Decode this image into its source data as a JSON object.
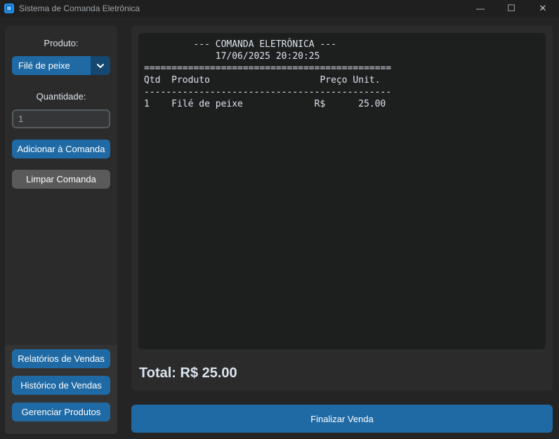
{
  "window": {
    "title": "Sistema de Comanda Eletrônica",
    "minimize_glyph": "—",
    "maximize_glyph": "☐",
    "close_glyph": "✕"
  },
  "sidebar": {
    "produto_label": "Produto:",
    "produto_selected": "Filé de peixe",
    "quantidade_label": "Quantidade:",
    "quantidade_value": "1",
    "add_button": "Adicionar à Comanda",
    "clear_button": "Limpar Comanda",
    "reports_button": "Relatórios de Vendas",
    "history_button": "Histórico de Vendas",
    "manage_button": "Gerenciar Produtos"
  },
  "receipt": {
    "text": "         --- COMANDA ELETRÔNICA ---\n             17/06/2025 20:20:25\n=============================================\nQtd  Produto                    Preço Unit.\n---------------------------------------------\n1    Filé de peixe             R$      25.00"
  },
  "total_label": "Total: R$ 25.00",
  "finalize_button": "Finalizar Venda",
  "colors": {
    "accent": "#1f6aa5",
    "accent_dark": "#144870",
    "background": "#242424",
    "panel": "#2b2b2b",
    "receipt_bg": "#1d1e1e",
    "secondary_button": "#5a5a5a"
  }
}
